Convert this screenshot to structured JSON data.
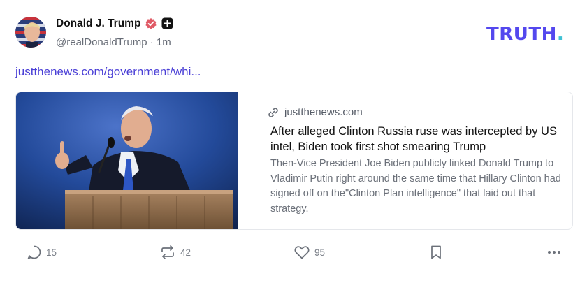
{
  "post": {
    "author_name": "Donald J. Trump",
    "handle": "@realDonaldTrump",
    "separator": "·",
    "time_ago": "1m",
    "link_text": "justthenews.com/government/whi..."
  },
  "brand": {
    "logo_text": "TRUTH",
    "logo_dot": "."
  },
  "card": {
    "domain": "justthenews.com",
    "title": "After alleged Clinton Russia ruse was intercepted by US intel, Biden took first shot smearing Trump",
    "description": "Then-Vice President Joe Biden publicly linked Donald Trump to Vladimir Putin right around the same time that Hillary Clinton had signed off on the\"Clinton Plan intelligence\" that laid out that strategy."
  },
  "actions": {
    "replies": "15",
    "retruths": "42",
    "likes": "95"
  },
  "colors": {
    "brand": "#5448ee",
    "brand_accent": "#3fc1d4",
    "link": "#4a3fd6",
    "verified": "#e05a66"
  },
  "icons": [
    "verified-icon",
    "plus-icon",
    "link-icon",
    "reply-icon",
    "retruth-icon",
    "like-icon",
    "bookmark-icon",
    "more-icon"
  ]
}
